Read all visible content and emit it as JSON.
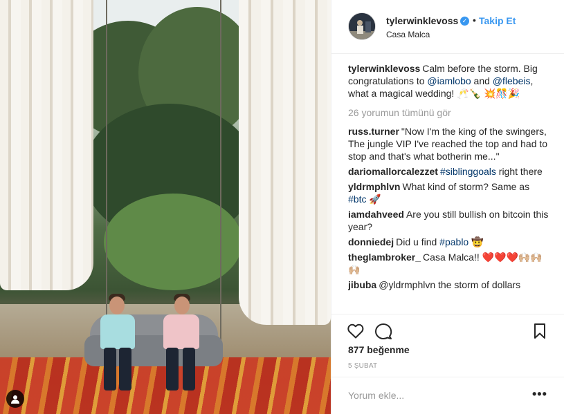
{
  "header": {
    "username": "tylerwinklevoss",
    "verified_icon": "verified-badge-icon",
    "separator": "•",
    "follow_label": "Takip Et",
    "location": "Casa Malca"
  },
  "caption": {
    "username": "tylerwinklevoss",
    "text_1": "Calm before the storm. Big congratulations to ",
    "mention_1": "@iamlobo",
    "text_2": " and ",
    "mention_2": "@flebeis",
    "text_3": ", what a magical wedding! 🥂🍾 💥🎊🎉"
  },
  "view_all_comments": "26 yorumun tümünü gör",
  "comments": [
    {
      "username": "russ.turner",
      "text": "\"Now I'm the king of the swingers,\nThe jungle VIP I've reached the top and had to stop and that's what botherin me...\""
    },
    {
      "username": "dariomallorcalezzet",
      "tag": "#siblinggoals",
      "text": " right there"
    },
    {
      "username": "yldrmphlvn",
      "text": "What kind of storm? Same as ",
      "tag": "#btc",
      "text_after": " 🚀"
    },
    {
      "username": "iamdahveed",
      "text": "Are you still bullish on bitcoin this year?"
    },
    {
      "username": "donniedej",
      "text": "Did u find ",
      "tag": "#pablo",
      "text_after": " 🤠"
    },
    {
      "username": "theglambroker_",
      "text": "Casa Malca!! ❤️❤️❤️🙌🏼🙌🏼🙌🏼"
    },
    {
      "username": "jibuba",
      "text": "@yldrmphlvn the storm of dollars"
    }
  ],
  "actions": {
    "like_icon": "heart-icon",
    "comment_icon": "comment-icon",
    "save_icon": "bookmark-icon"
  },
  "likes": "877 beğenme",
  "date": "5 ŞUBAT",
  "add_comment": {
    "placeholder": "Yorum ekle...",
    "more_label": "•••"
  },
  "photo": {
    "user_tag_icon": "user-tag-icon"
  }
}
